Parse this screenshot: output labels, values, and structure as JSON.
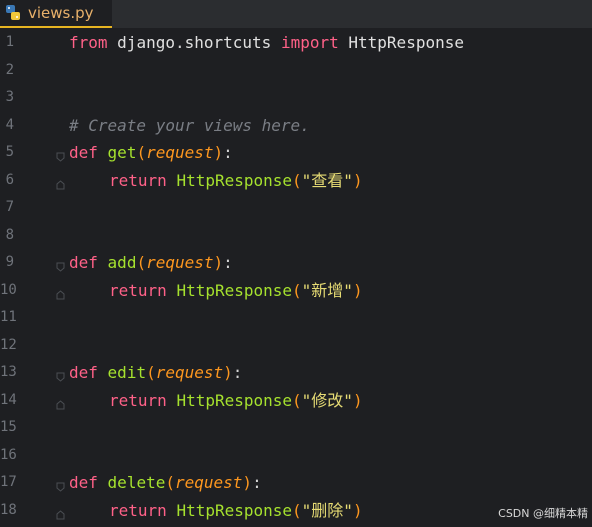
{
  "tab": {
    "label": "views.py"
  },
  "line_numbers": [
    "1",
    "2",
    "3",
    "4",
    "5",
    "6",
    "7",
    "8",
    "9",
    "10",
    "11",
    "12",
    "13",
    "14",
    "15",
    "16",
    "17",
    "18"
  ],
  "code": {
    "l1": {
      "kw1": "from",
      "mod": "django",
      "dot": ".",
      "mod2": "shortcuts",
      "kw2": "import",
      "cls": "HttpResponse"
    },
    "l4": {
      "comment": "# Create your views here."
    },
    "defs": [
      {
        "kw": "def",
        "name": "get",
        "param": "request",
        "ret": "return",
        "cls": "HttpResponse",
        "str": "\"查看\""
      },
      {
        "kw": "def",
        "name": "add",
        "param": "request",
        "ret": "return",
        "cls": "HttpResponse",
        "str": "\"新增\""
      },
      {
        "kw": "def",
        "name": "edit",
        "param": "request",
        "ret": "return",
        "cls": "HttpResponse",
        "str": "\"修改\""
      },
      {
        "kw": "def",
        "name": "delete",
        "param": "request",
        "ret": "return",
        "cls": "HttpResponse",
        "str": "\"删除\""
      }
    ]
  },
  "watermark": "CSDN @细精本精"
}
